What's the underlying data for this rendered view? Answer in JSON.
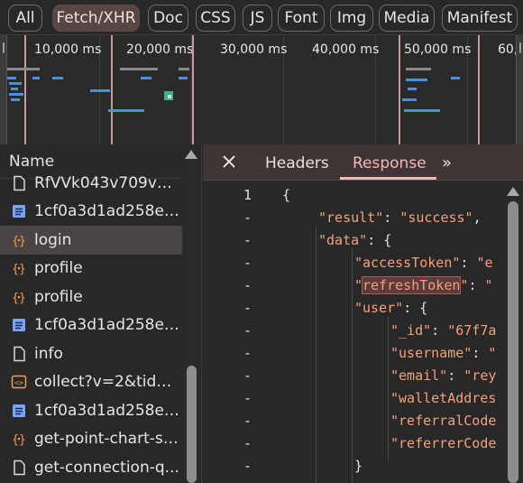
{
  "filters": [
    "All",
    "Fetch/XHR",
    "Doc",
    "CSS",
    "JS",
    "Font",
    "Img",
    "Media",
    "Manifest"
  ],
  "active_filter": "Fetch/XHR",
  "overview": {
    "tick_labels": [
      "10,000 ms",
      "20,000 ms",
      "30,000 ms",
      "40,000 ms",
      "50,000 ms",
      "60,"
    ]
  },
  "list": {
    "header": "Name",
    "rows": [
      {
        "name": "RfVVk043v709vw...",
        "type": "doc"
      },
      {
        "name": "1cf0a3d1ad258e5...",
        "type": "script"
      },
      {
        "name": "login",
        "type": "fetch",
        "selected": true
      },
      {
        "name": "profile",
        "type": "fetch"
      },
      {
        "name": "profile",
        "type": "fetch"
      },
      {
        "name": "1cf0a3d1ad258e5...",
        "type": "script"
      },
      {
        "name": "info",
        "type": "doc"
      },
      {
        "name": "collect?v=2&tid=...",
        "type": "orange"
      },
      {
        "name": "1cf0a3d1ad258e5...",
        "type": "script"
      },
      {
        "name": "get-point-chart-st...",
        "type": "fetch"
      },
      {
        "name": "get-connection-q...",
        "type": "doc"
      }
    ]
  },
  "detail": {
    "tabs": {
      "headers": "Headers",
      "response": "Response",
      "more": "»"
    },
    "lines": [
      {
        "num": "1",
        "indent": 0,
        "text": "{"
      },
      {
        "num": "-",
        "indent": 1,
        "key": "\"result\"",
        "value": "\"success\"",
        "tail": ","
      },
      {
        "num": "-",
        "indent": 1,
        "key": "\"data\"",
        "tail": ": {"
      },
      {
        "num": "-",
        "indent": 2,
        "key": "\"accessToken\"",
        "value": "\"e"
      },
      {
        "num": "-",
        "indent": 2,
        "key_prefix": "\"",
        "key_hl": "refreshToken",
        "key_suffix": "\"",
        "value": "\""
      },
      {
        "num": "-",
        "indent": 2,
        "key": "\"user\"",
        "tail": ": {"
      },
      {
        "num": "-",
        "indent": 3,
        "key": "\"_id\"",
        "value": "\"67f7a"
      },
      {
        "num": "-",
        "indent": 3,
        "key": "\"username\"",
        "value": "\""
      },
      {
        "num": "-",
        "indent": 3,
        "key": "\"email\"",
        "value": "\"rey"
      },
      {
        "num": "-",
        "indent": 3,
        "key": "\"walletAddres"
      },
      {
        "num": "-",
        "indent": 3,
        "key": "\"referralCode"
      },
      {
        "num": "-",
        "indent": 3,
        "key": "\"referrerCode"
      },
      {
        "num": "-",
        "indent": 2,
        "text": "}"
      }
    ]
  },
  "colors": {
    "accent": "#f2b8b5",
    "json_string": "#f6a07a",
    "fetch_icon": "#e8a060",
    "script_icon": "#7aa3ff",
    "timeline_blue": "#4a8fe7",
    "timeline_green": "#3fb27f"
  }
}
